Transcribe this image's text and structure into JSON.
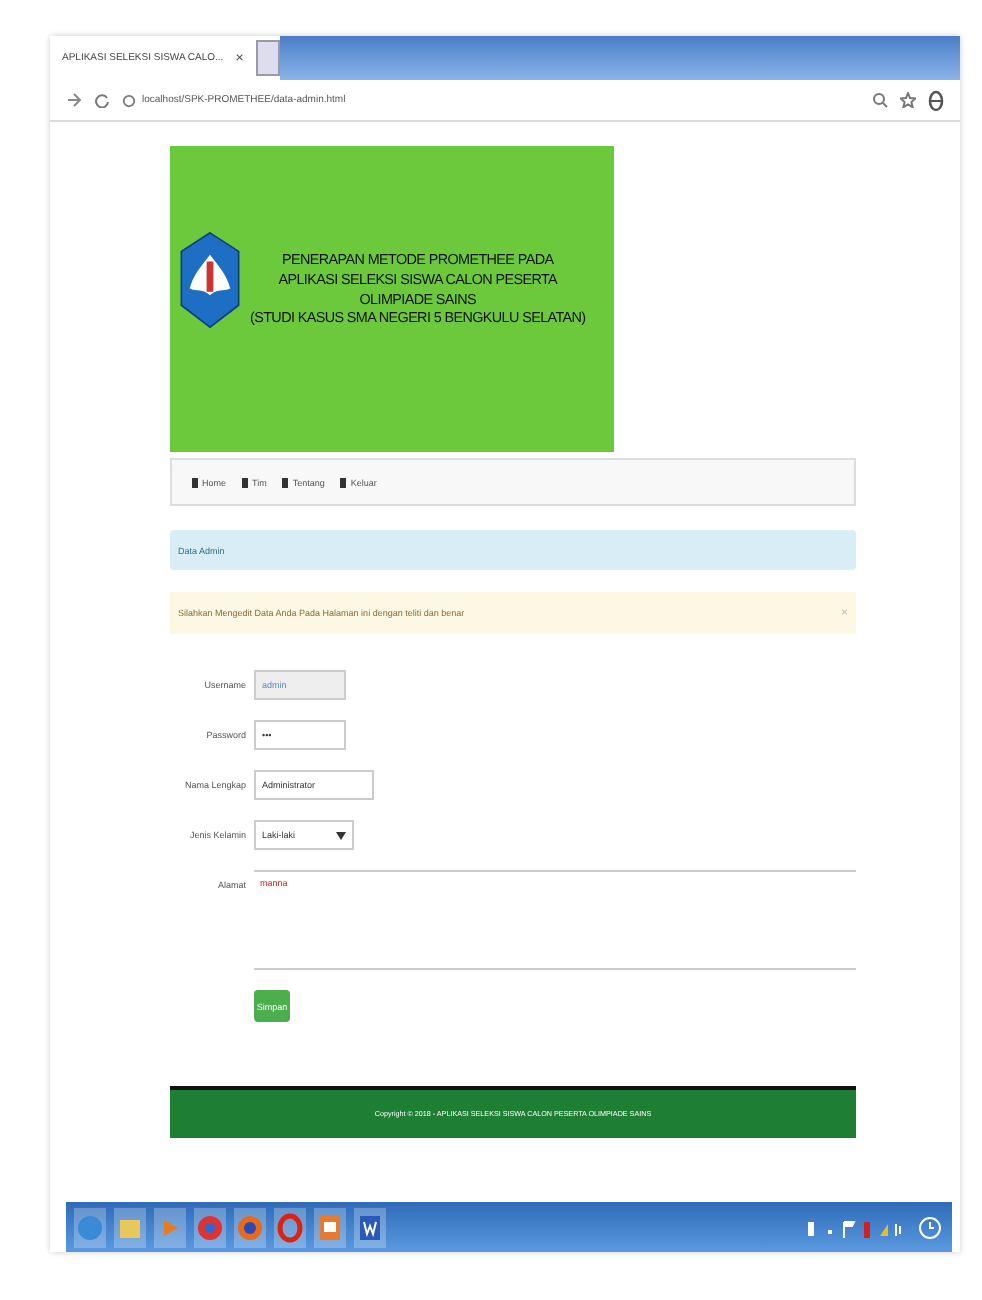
{
  "browser": {
    "tab_title": "APLIKASI SELEKSI SISWA CALO...",
    "close": "×",
    "url": "localhost/SPK-PROMETHEE/data-admin.html"
  },
  "header": {
    "lines": [
      "PENERAPAN METODE PROMETHEE PADA",
      "APLIKASI SELEKSI SISWA CALON PESERTA",
      "OLIMPIADE SAINS",
      "(STUDI KASUS SMA NEGERI 5  BENGKULU SELATAN)"
    ]
  },
  "nav": [
    {
      "label": "Home"
    },
    {
      "label": "Tim"
    },
    {
      "label": "Tentang"
    },
    {
      "label": "Keluar"
    }
  ],
  "panel_title": "Data Admin",
  "alert": {
    "text": "Silahkan Mengedit Data Anda Pada Halaman ini dengan teliti dan benar",
    "close": "×"
  },
  "form": [
    {
      "kind": "text",
      "label": "Username",
      "value": "admin",
      "disabled": true
    },
    {
      "kind": "text",
      "label": "Password",
      "value": "•••",
      "disabled": false
    },
    {
      "kind": "text",
      "label": "Nama Lengkap",
      "value": "Administrator",
      "disabled": false
    },
    {
      "kind": "select",
      "label": "Jenis Kelamin",
      "value": "Laki-laki"
    },
    {
      "kind": "textarea",
      "label": "Alamat",
      "value": "manna"
    }
  ],
  "submit": "Simpan",
  "footer": "Copyright © 2018 - APLIKASI SELEKSI SISWA CALON PESERTA OLIMPIADE SAINS"
}
